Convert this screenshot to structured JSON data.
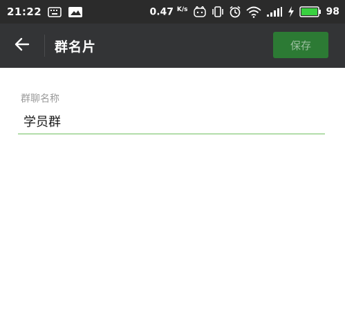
{
  "status_bar": {
    "time": "21:22",
    "net_speed_value": "0.47",
    "net_speed_unit": "K/s",
    "battery_level": "98",
    "icons": [
      "keyboard-icon",
      "image-notification-icon",
      "app-notification-icon",
      "vibrate-icon",
      "alarm-icon",
      "wifi-icon",
      "signal-icon",
      "charging-icon",
      "battery-icon"
    ]
  },
  "header": {
    "title": "群名片",
    "save_label": "保存",
    "back_icon": "arrow-left-icon"
  },
  "form": {
    "group_name_label": "群聊名称",
    "group_name_value": "学员群"
  },
  "colors": {
    "status_bar_bg": "#2b2b2b",
    "header_bg": "#333436",
    "save_button_bg": "#2c7a34",
    "input_underline": "#6fbf5f"
  }
}
